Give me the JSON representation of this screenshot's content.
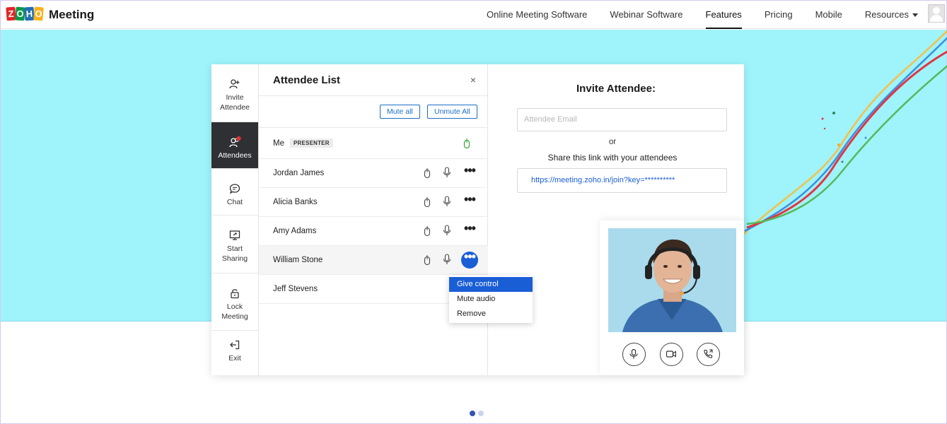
{
  "header": {
    "logo_letters": [
      "Z",
      "O",
      "H",
      "O"
    ],
    "logo_colors": [
      "#e42527",
      "#089949",
      "#226db4",
      "#f9b21d"
    ],
    "brand": "Meeting",
    "nav": [
      {
        "label": "Online Meeting Software"
      },
      {
        "label": "Webinar Software"
      },
      {
        "label": "Features"
      },
      {
        "label": "Pricing"
      },
      {
        "label": "Mobile"
      },
      {
        "label": "Resources"
      }
    ]
  },
  "sidebar": {
    "items": [
      {
        "label1": "Invite",
        "label2": "Attendee"
      },
      {
        "label1": "Attendees",
        "label2": ""
      },
      {
        "label1": "Chat",
        "label2": ""
      },
      {
        "label1": "Start",
        "label2": "Sharing"
      },
      {
        "label1": "Lock",
        "label2": "Meeting"
      },
      {
        "label1": "Exit",
        "label2": ""
      }
    ]
  },
  "attendee_list": {
    "title": "Attendee List",
    "close": "×",
    "mute_all": "Mute all",
    "unmute_all": "Unmute All",
    "me": "Me",
    "presenter_badge": "PRESENTER",
    "rows": [
      {
        "name": "Jordan James"
      },
      {
        "name": "Alicia Banks"
      },
      {
        "name": "Amy Adams"
      },
      {
        "name": "William Stone"
      },
      {
        "name": "Jeff Stevens"
      }
    ],
    "more": "•••",
    "menu": [
      "Give control",
      "Mute audio",
      "Remove"
    ]
  },
  "invite": {
    "title": "Invite Attendee:",
    "email_placeholder": "Attendee Email",
    "or": "or",
    "share_text": "Share this link with your attendees",
    "link": "https://meeting.zoho.in/join?key=**********"
  },
  "colors": {
    "hero": "#9ff3fb",
    "accent": "#1a5ed6",
    "active_sidebar": "#2f3033",
    "dot_active": "#3454b4",
    "dot_inactive": "#c9d3ee"
  }
}
